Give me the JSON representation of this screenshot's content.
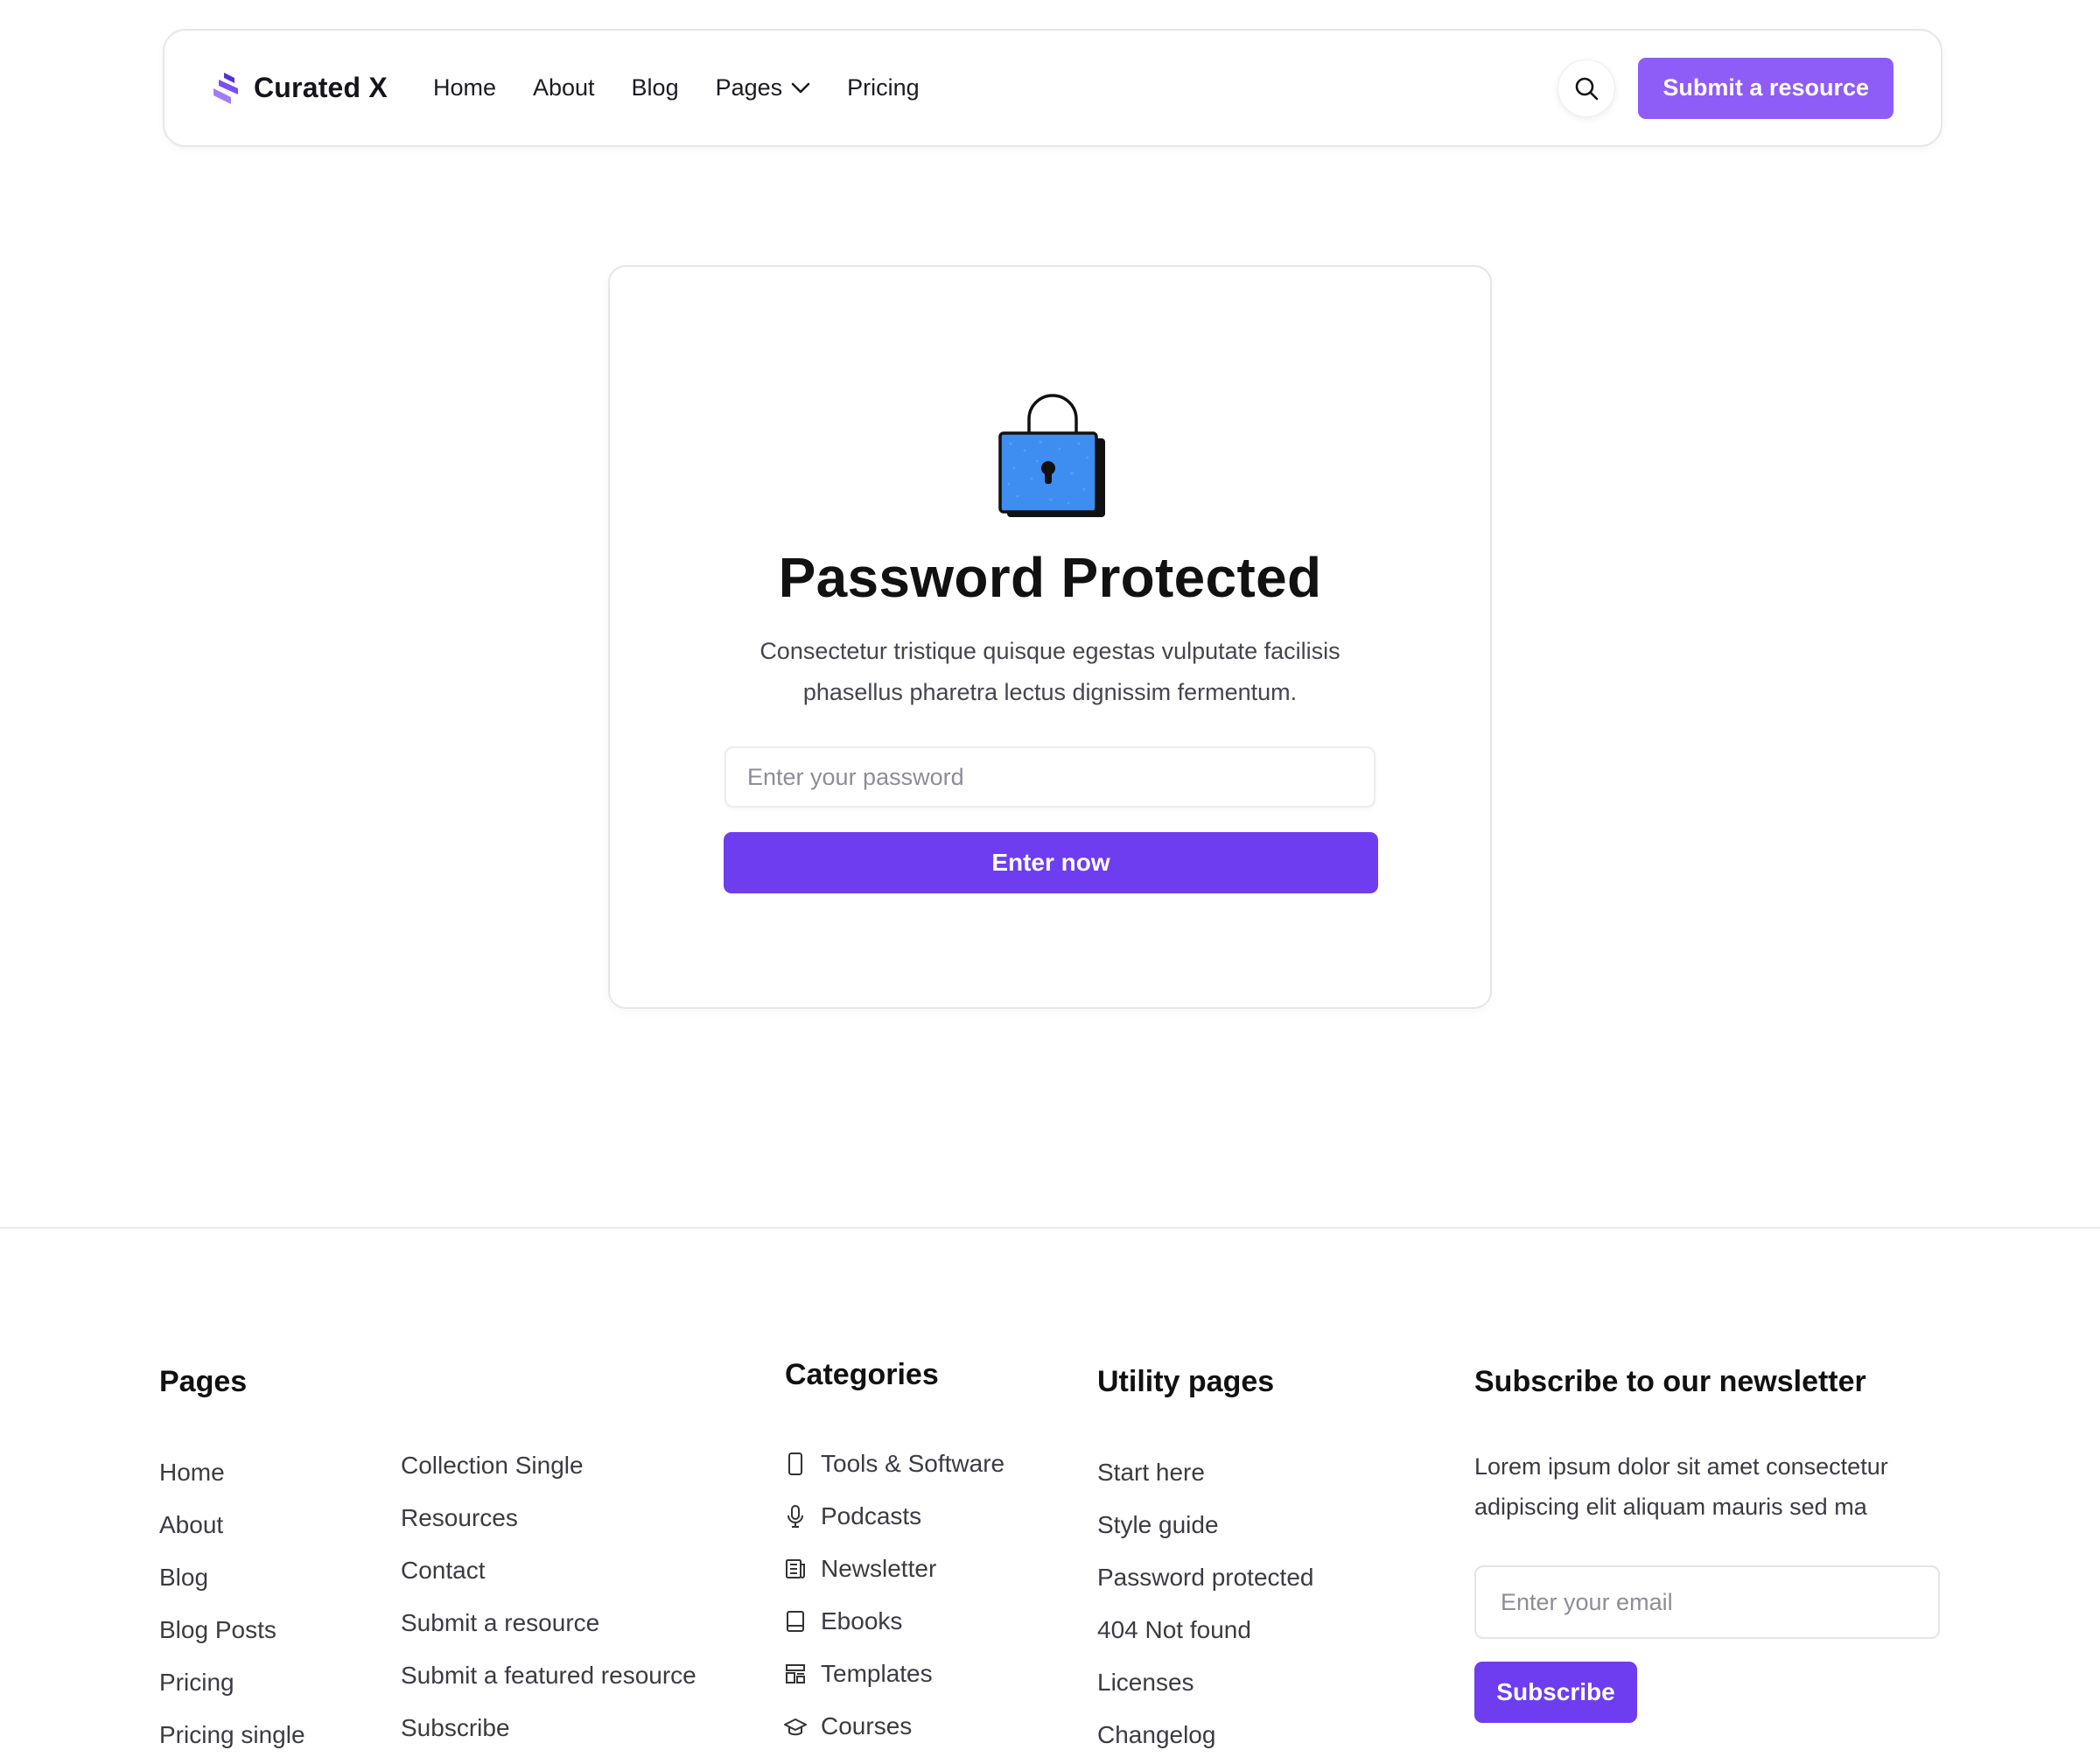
{
  "header": {
    "brand": "Curated X",
    "nav": [
      {
        "label": "Home"
      },
      {
        "label": "About"
      },
      {
        "label": "Blog"
      },
      {
        "label": "Pages"
      },
      {
        "label": "Pricing"
      }
    ],
    "submit_label": "Submit a resource"
  },
  "main": {
    "title": "Password Protected",
    "description": "Consectetur tristique quisque egestas vulputate facilisis phasellus pharetra lectus dignissim fermentum.",
    "password_placeholder": "Enter your password",
    "enter_label": "Enter now"
  },
  "footer": {
    "pages": {
      "heading": "Pages",
      "col1": [
        "Home",
        "About",
        "Blog",
        "Blog Posts",
        "Pricing",
        "Pricing single"
      ],
      "col2": [
        "Collection Single",
        "Resources",
        "Contact",
        "Submit a resource",
        "Submit a featured resource",
        "Subscribe"
      ]
    },
    "categories": {
      "heading": "Categories",
      "items": [
        {
          "label": "Tools & Software",
          "icon": "phone-icon"
        },
        {
          "label": "Podcasts",
          "icon": "microphone-icon"
        },
        {
          "label": "Newsletter",
          "icon": "newspaper-icon"
        },
        {
          "label": "Ebooks",
          "icon": "book-icon"
        },
        {
          "label": "Templates",
          "icon": "template-icon"
        },
        {
          "label": "Courses",
          "icon": "graduation-cap-icon"
        }
      ]
    },
    "utility": {
      "heading": "Utility pages",
      "items": [
        "Start here",
        "Style guide",
        "Password protected",
        "404 Not found",
        "Licenses",
        "Changelog"
      ]
    },
    "newsletter": {
      "heading": "Subscribe to our newsletter",
      "description": "Lorem ipsum dolor sit amet consectetur adipiscing elit aliquam mauris sed ma",
      "email_placeholder": "Enter your email",
      "subscribe_label": "Subscribe"
    }
  },
  "colors": {
    "accent": "#6e3df0",
    "accent_light": "#8e5cf7",
    "lock_blue": "#3d8ef0"
  }
}
